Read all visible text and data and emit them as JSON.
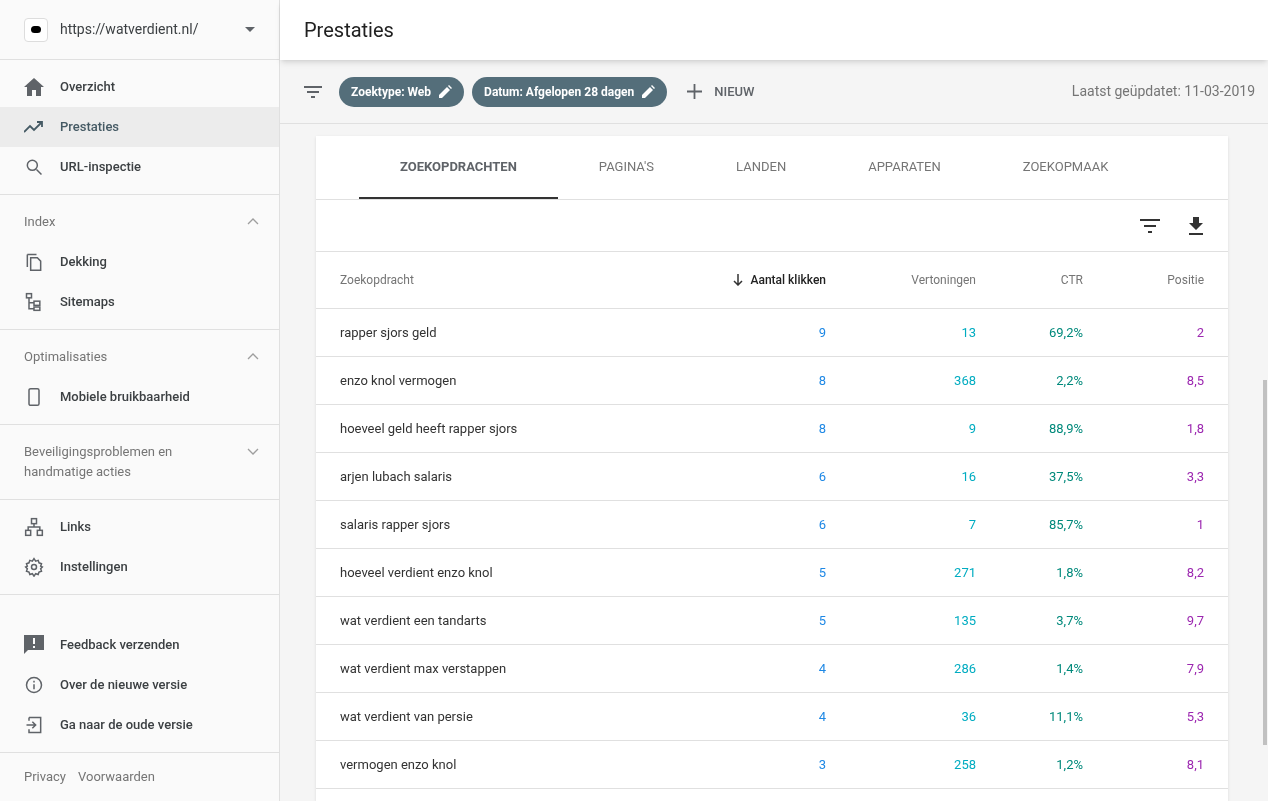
{
  "sidebar": {
    "site": {
      "url": "https://watverdient.nl/"
    },
    "groups": [
      {
        "items": [
          {
            "label": "Overzicht",
            "selected": false
          },
          {
            "label": "Prestaties",
            "selected": true
          },
          {
            "label": "URL-inspectie",
            "selected": false
          }
        ]
      },
      {
        "title": "Index",
        "expanded": true,
        "items": [
          {
            "label": "Dekking",
            "selected": false
          },
          {
            "label": "Sitemaps",
            "selected": false
          }
        ]
      },
      {
        "title": "Optimalisaties",
        "expanded": true,
        "items": [
          {
            "label": "Mobiele bruikbaarheid",
            "selected": false
          }
        ]
      },
      {
        "title": "Beveiligingsproblemen en handmatige acties",
        "expanded": false
      },
      {
        "items": [
          {
            "label": "Links",
            "selected": false
          },
          {
            "label": "Instellingen",
            "selected": false
          }
        ]
      }
    ],
    "bottom_items": [
      {
        "label": "Feedback verzenden"
      },
      {
        "label": "Over de nieuwe versie"
      },
      {
        "label": "Ga naar de oude versie"
      }
    ],
    "footer_links": [
      "Privacy",
      "Voorwaarden"
    ]
  },
  "header": {
    "title": "Prestaties"
  },
  "filter_bar": {
    "chips": [
      "Zoektype: Web",
      "Datum: Afgelopen 28 dagen"
    ],
    "new_button": "NIEUW",
    "last_updated": "Laatst geüpdatet: 11-03-2019"
  },
  "tabs": [
    {
      "label": "ZOEKOPDRACHTEN",
      "selected": true
    },
    {
      "label": "PAGINA'S",
      "selected": false
    },
    {
      "label": "LANDEN",
      "selected": false
    },
    {
      "label": "APPARATEN",
      "selected": false
    },
    {
      "label": "ZOEKOPMAAK",
      "selected": false
    }
  ],
  "table": {
    "columns": [
      {
        "label": "Zoekopdracht",
        "sorted": false
      },
      {
        "label": "Aantal klikken",
        "sorted": true
      },
      {
        "label": "Vertoningen",
        "sorted": false
      },
      {
        "label": "CTR",
        "sorted": false
      },
      {
        "label": "Positie",
        "sorted": false
      }
    ],
    "rows": [
      [
        "rapper sjors geld",
        "9",
        "13",
        "69,2%",
        "2"
      ],
      [
        "enzo knol vermogen",
        "8",
        "368",
        "2,2%",
        "8,5"
      ],
      [
        "hoeveel geld heeft rapper sjors",
        "8",
        "9",
        "88,9%",
        "1,8"
      ],
      [
        "arjen lubach salaris",
        "6",
        "16",
        "37,5%",
        "3,3"
      ],
      [
        "salaris rapper sjors",
        "6",
        "7",
        "85,7%",
        "1"
      ],
      [
        "hoeveel verdient enzo knol",
        "5",
        "271",
        "1,8%",
        "8,2"
      ],
      [
        "wat verdient een tandarts",
        "5",
        "135",
        "3,7%",
        "9,7"
      ],
      [
        "wat verdient max verstappen",
        "4",
        "286",
        "1,4%",
        "7,9"
      ],
      [
        "wat verdient van persie",
        "4",
        "36",
        "11,1%",
        "5,3"
      ],
      [
        "vermogen enzo knol",
        "3",
        "258",
        "1,2%",
        "8,1"
      ]
    ]
  }
}
